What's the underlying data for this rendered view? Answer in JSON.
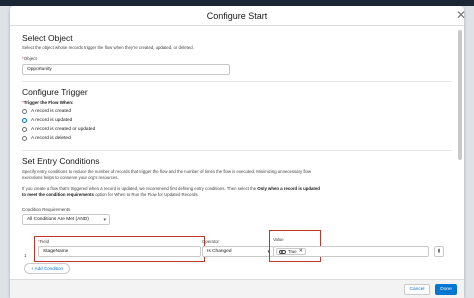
{
  "modal": {
    "title": "Configure Start"
  },
  "select_object": {
    "heading": "Select Object",
    "description": "Select the object whose records trigger the flow when they're created, updated, or deleted.",
    "object_label": "Object",
    "object_value": "Opportunity"
  },
  "configure_trigger": {
    "heading": "Configure Trigger",
    "trigger_label": "Trigger the Flow When:",
    "options": [
      {
        "label": "A record is created",
        "selected": false
      },
      {
        "label": "A record is updated",
        "selected": true
      },
      {
        "label": "A record is created or updated",
        "selected": false
      },
      {
        "label": "A record is deleted",
        "selected": false
      }
    ]
  },
  "entry_conditions": {
    "heading": "Set Entry Conditions",
    "desc1_line1": "Specify entry conditions to reduce the number of records that trigger the flow and the number of times the flow is executed. Minimizing unnecessary flow",
    "desc1_line2": "executions helps to conserve your org's resources.",
    "desc2_line1_prefix": "If you create a flow that's triggered when a record is updated, we recommend first defining entry conditions. Then select the",
    "desc2_line1_bold": "Only when a record is updated",
    "desc2_line2_bold": "to meet the condition requirements",
    "desc2_line2_suffix": "option for When to Run the Flow for Updated Records.",
    "requirements_label": "Condition Requirements",
    "requirements_value": "All Conditions Are Met (AND)",
    "row_number": "1",
    "field_label": "Field",
    "field_value": "StageName",
    "operator_label": "Operator",
    "operator_value": "Is Changed",
    "value_label": "Value",
    "value_pill": "True",
    "add_condition": "+ Add Condition"
  },
  "footer": {
    "cancel": "Cancel",
    "done": "Done"
  },
  "colors": {
    "brand_blue": "#0176d3",
    "highlight_red": "#c0392b"
  }
}
